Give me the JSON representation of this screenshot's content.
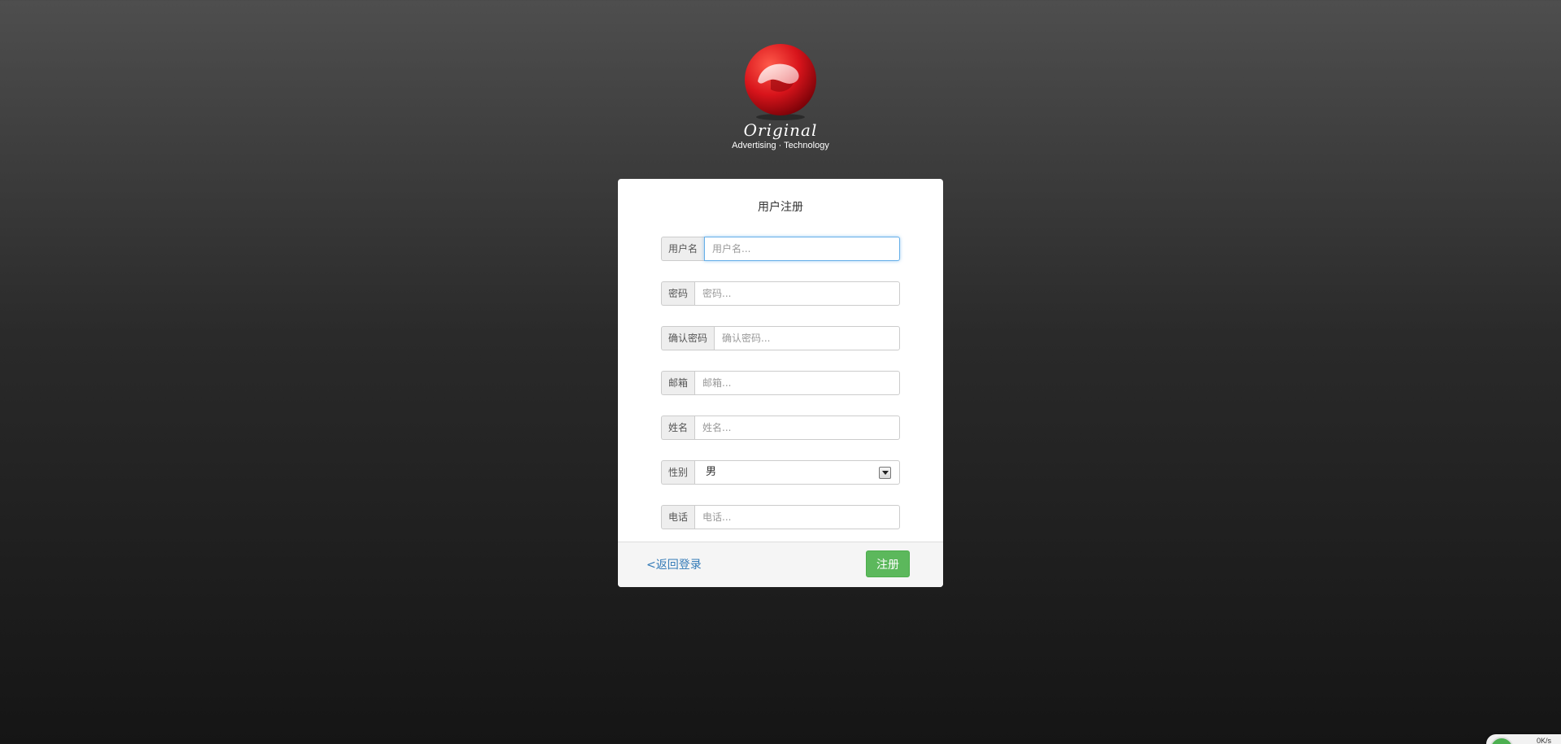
{
  "brand": {
    "name": "Original",
    "tagline": "Advertising · Technology",
    "mark_color": "#d8141b"
  },
  "form": {
    "title": "用户注册",
    "fields": [
      {
        "label": "用户名",
        "placeholder": "用户名..."
      },
      {
        "label": "密码",
        "placeholder": "密码..."
      },
      {
        "label": "确认密码",
        "placeholder": "确认密码..."
      },
      {
        "label": "邮箱",
        "placeholder": "邮箱..."
      },
      {
        "label": "姓名",
        "placeholder": "姓名..."
      },
      {
        "label": "性别",
        "selected": "男"
      },
      {
        "label": "电话",
        "placeholder": "电话..."
      }
    ],
    "back_link": "<返回登录",
    "submit_label": "注册",
    "submit_color": "#5cb85c",
    "link_color": "#337ab7"
  },
  "net_widget": {
    "text": "0K/s"
  }
}
